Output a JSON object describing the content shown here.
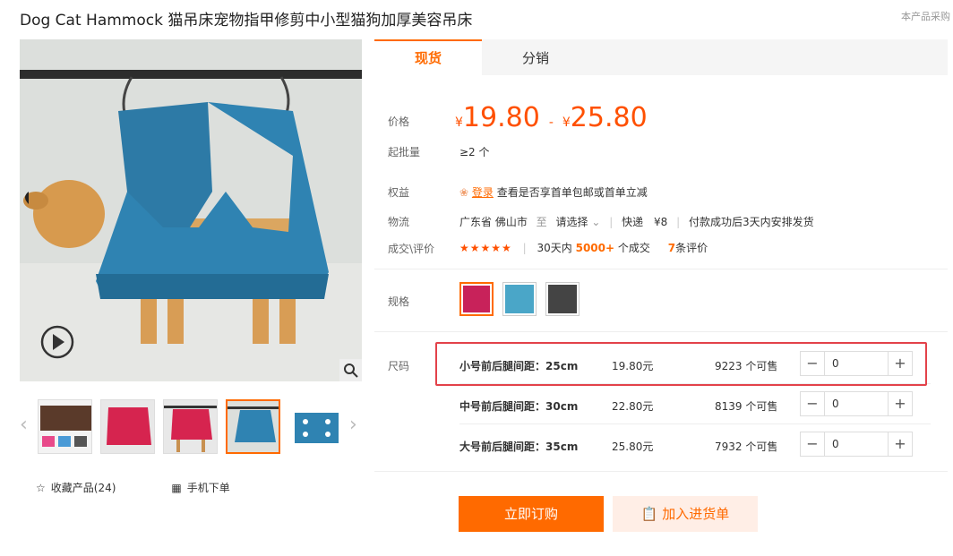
{
  "title": "Dog Cat Hammock 猫吊床宠物指甲修剪中小型猫狗加厚美容吊床",
  "top_right": "本产品采购",
  "tabs": [
    "现货",
    "分销"
  ],
  "price": {
    "label": "价格",
    "currency": "¥",
    "low": "19.80",
    "dash": "-",
    "high": "25.80"
  },
  "moq": {
    "label": "起批量",
    "value": "≥2 个"
  },
  "benefit": {
    "label": "权益",
    "link": "登录",
    "text": "查看是否享首单包邮或首单立减"
  },
  "logistics": {
    "label": "物流",
    "from": "广东省 佛山市",
    "to_label": "至",
    "select": "请选择",
    "method": "快递",
    "fee": "¥8",
    "note": "付款成功后3天内安排发货"
  },
  "deals": {
    "label": "成交\\评价",
    "stars": "★★★★★",
    "prefix": "30天内",
    "count": "5000+",
    "suffix": "个成交",
    "reviews": "7",
    "reviews_suffix": "条评价"
  },
  "spec": {
    "label": "规格"
  },
  "size": {
    "label": "尺码"
  },
  "skus": [
    {
      "name": "小号前后腿间距：25cm",
      "price": "19.80元",
      "stock": "9223 个可售",
      "qty": "0"
    },
    {
      "name": "中号前后腿间距：30cm",
      "price": "22.80元",
      "stock": "8139 个可售",
      "qty": "0"
    },
    {
      "name": "大号前后腿间距：35cm",
      "price": "25.80元",
      "stock": "7932 个可售",
      "qty": "0"
    }
  ],
  "actions": {
    "favorite": "收藏产品(24)",
    "mobile": "手机下单"
  },
  "buttons": {
    "buy": "立即订购",
    "cart": "加入进货单"
  },
  "stepper": {
    "minus": "−",
    "plus": "+"
  },
  "colors": {
    "accent": "#ff6a00",
    "price": "#ff5000",
    "highlight": "#e3424a"
  }
}
